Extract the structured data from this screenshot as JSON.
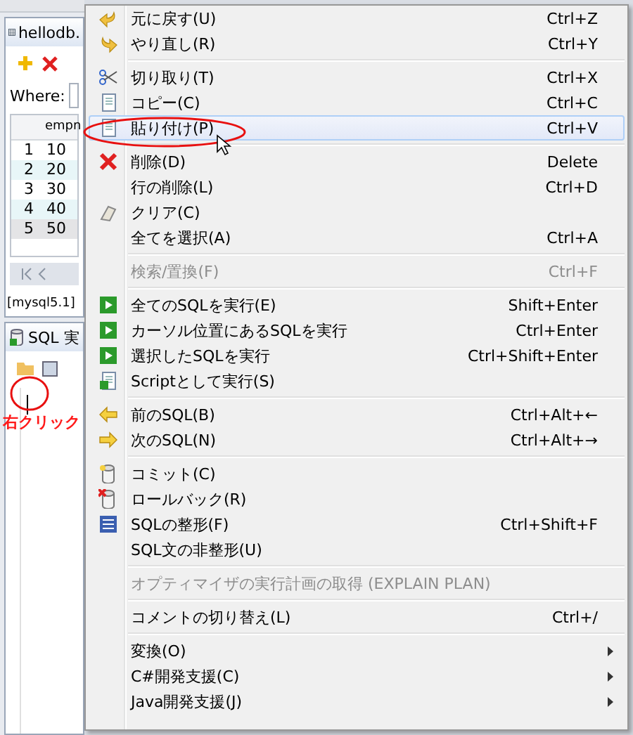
{
  "background": {
    "table_panel": {
      "tab": "hellodb.",
      "where_label": "Where:",
      "column_header": "empn",
      "rows": [
        {
          "number": "1",
          "value": "10",
          "selected": false
        },
        {
          "number": "2",
          "value": "20",
          "selected": false
        },
        {
          "number": "3",
          "value": "30",
          "selected": false
        },
        {
          "number": "4",
          "value": "40",
          "selected": false
        },
        {
          "number": "5",
          "value": "50",
          "selected": true
        }
      ],
      "connection": "[mysql5.1]"
    },
    "sql_panel": {
      "tab": "SQL 実"
    }
  },
  "annotation": {
    "label": "右クリック"
  },
  "context_menu": [
    {
      "kind": "item",
      "label": "元に戻す(U)",
      "shortcut": "Ctrl+Z",
      "selected": false,
      "disabled": false
    },
    {
      "kind": "item",
      "label": "やり直し(R)",
      "shortcut": "Ctrl+Y",
      "selected": false,
      "disabled": false
    },
    {
      "kind": "separator"
    },
    {
      "kind": "item",
      "label": "切り取り(T)",
      "shortcut": "Ctrl+X",
      "selected": false,
      "disabled": false
    },
    {
      "kind": "item",
      "label": "コピー(C)",
      "shortcut": "Ctrl+C",
      "selected": false,
      "disabled": false
    },
    {
      "kind": "item",
      "label": "貼り付け(P)",
      "shortcut": "Ctrl+V",
      "selected": true,
      "disabled": false
    },
    {
      "kind": "separator"
    },
    {
      "kind": "item",
      "label": "削除(D)",
      "shortcut": "Delete",
      "selected": false,
      "disabled": false
    },
    {
      "kind": "item",
      "label": "行の削除(L)",
      "shortcut": "Ctrl+D",
      "selected": false,
      "disabled": false
    },
    {
      "kind": "item",
      "label": "クリア(C)",
      "selected": false,
      "disabled": false
    },
    {
      "kind": "item",
      "label": "全てを選択(A)",
      "shortcut": "Ctrl+A",
      "selected": false,
      "disabled": false
    },
    {
      "kind": "separator"
    },
    {
      "kind": "item",
      "label": "検索/置換(F)",
      "shortcut": "Ctrl+F",
      "selected": false,
      "disabled": true
    },
    {
      "kind": "separator"
    },
    {
      "kind": "item",
      "label": "全てのSQLを実行(E)",
      "shortcut": "Shift+Enter",
      "selected": false,
      "disabled": false
    },
    {
      "kind": "item",
      "label": "カーソル位置にあるSQLを実行",
      "shortcut": "Ctrl+Enter",
      "selected": false,
      "disabled": false
    },
    {
      "kind": "item",
      "label": "選択したSQLを実行",
      "shortcut": "Ctrl+Shift+Enter",
      "selected": false,
      "disabled": false
    },
    {
      "kind": "item",
      "label": "Scriptとして実行(S)",
      "selected": false,
      "disabled": false
    },
    {
      "kind": "separator"
    },
    {
      "kind": "item",
      "label": "前のSQL(B)",
      "shortcut": "Ctrl+Alt+←",
      "selected": false,
      "disabled": false
    },
    {
      "kind": "item",
      "label": "次のSQL(N)",
      "shortcut": "Ctrl+Alt+→",
      "selected": false,
      "disabled": false
    },
    {
      "kind": "separator"
    },
    {
      "kind": "item",
      "label": "コミット(C)",
      "selected": false,
      "disabled": false
    },
    {
      "kind": "item",
      "label": "ロールバック(R)",
      "selected": false,
      "disabled": false
    },
    {
      "kind": "item",
      "label": "SQLの整形(F)",
      "shortcut": "Ctrl+Shift+F",
      "selected": false,
      "disabled": false
    },
    {
      "kind": "item",
      "label": "SQL文の非整形(U)",
      "selected": false,
      "disabled": false
    },
    {
      "kind": "separator"
    },
    {
      "kind": "item",
      "label": "オプティマイザの実行計画の取得 (EXPLAIN PLAN)",
      "selected": false,
      "disabled": true
    },
    {
      "kind": "separator"
    },
    {
      "kind": "item",
      "label": "コメントの切り替え(L)",
      "shortcut": "Ctrl+/",
      "selected": false,
      "disabled": false
    },
    {
      "kind": "separator"
    },
    {
      "kind": "item",
      "label": "変換(O)",
      "selected": false,
      "disabled": false,
      "submenu": true
    },
    {
      "kind": "item",
      "label": "C#開発支援(C)",
      "selected": false,
      "disabled": false,
      "submenu": true
    },
    {
      "kind": "item",
      "label": "Java開発支援(J)",
      "selected": false,
      "disabled": false,
      "submenu": true
    }
  ]
}
